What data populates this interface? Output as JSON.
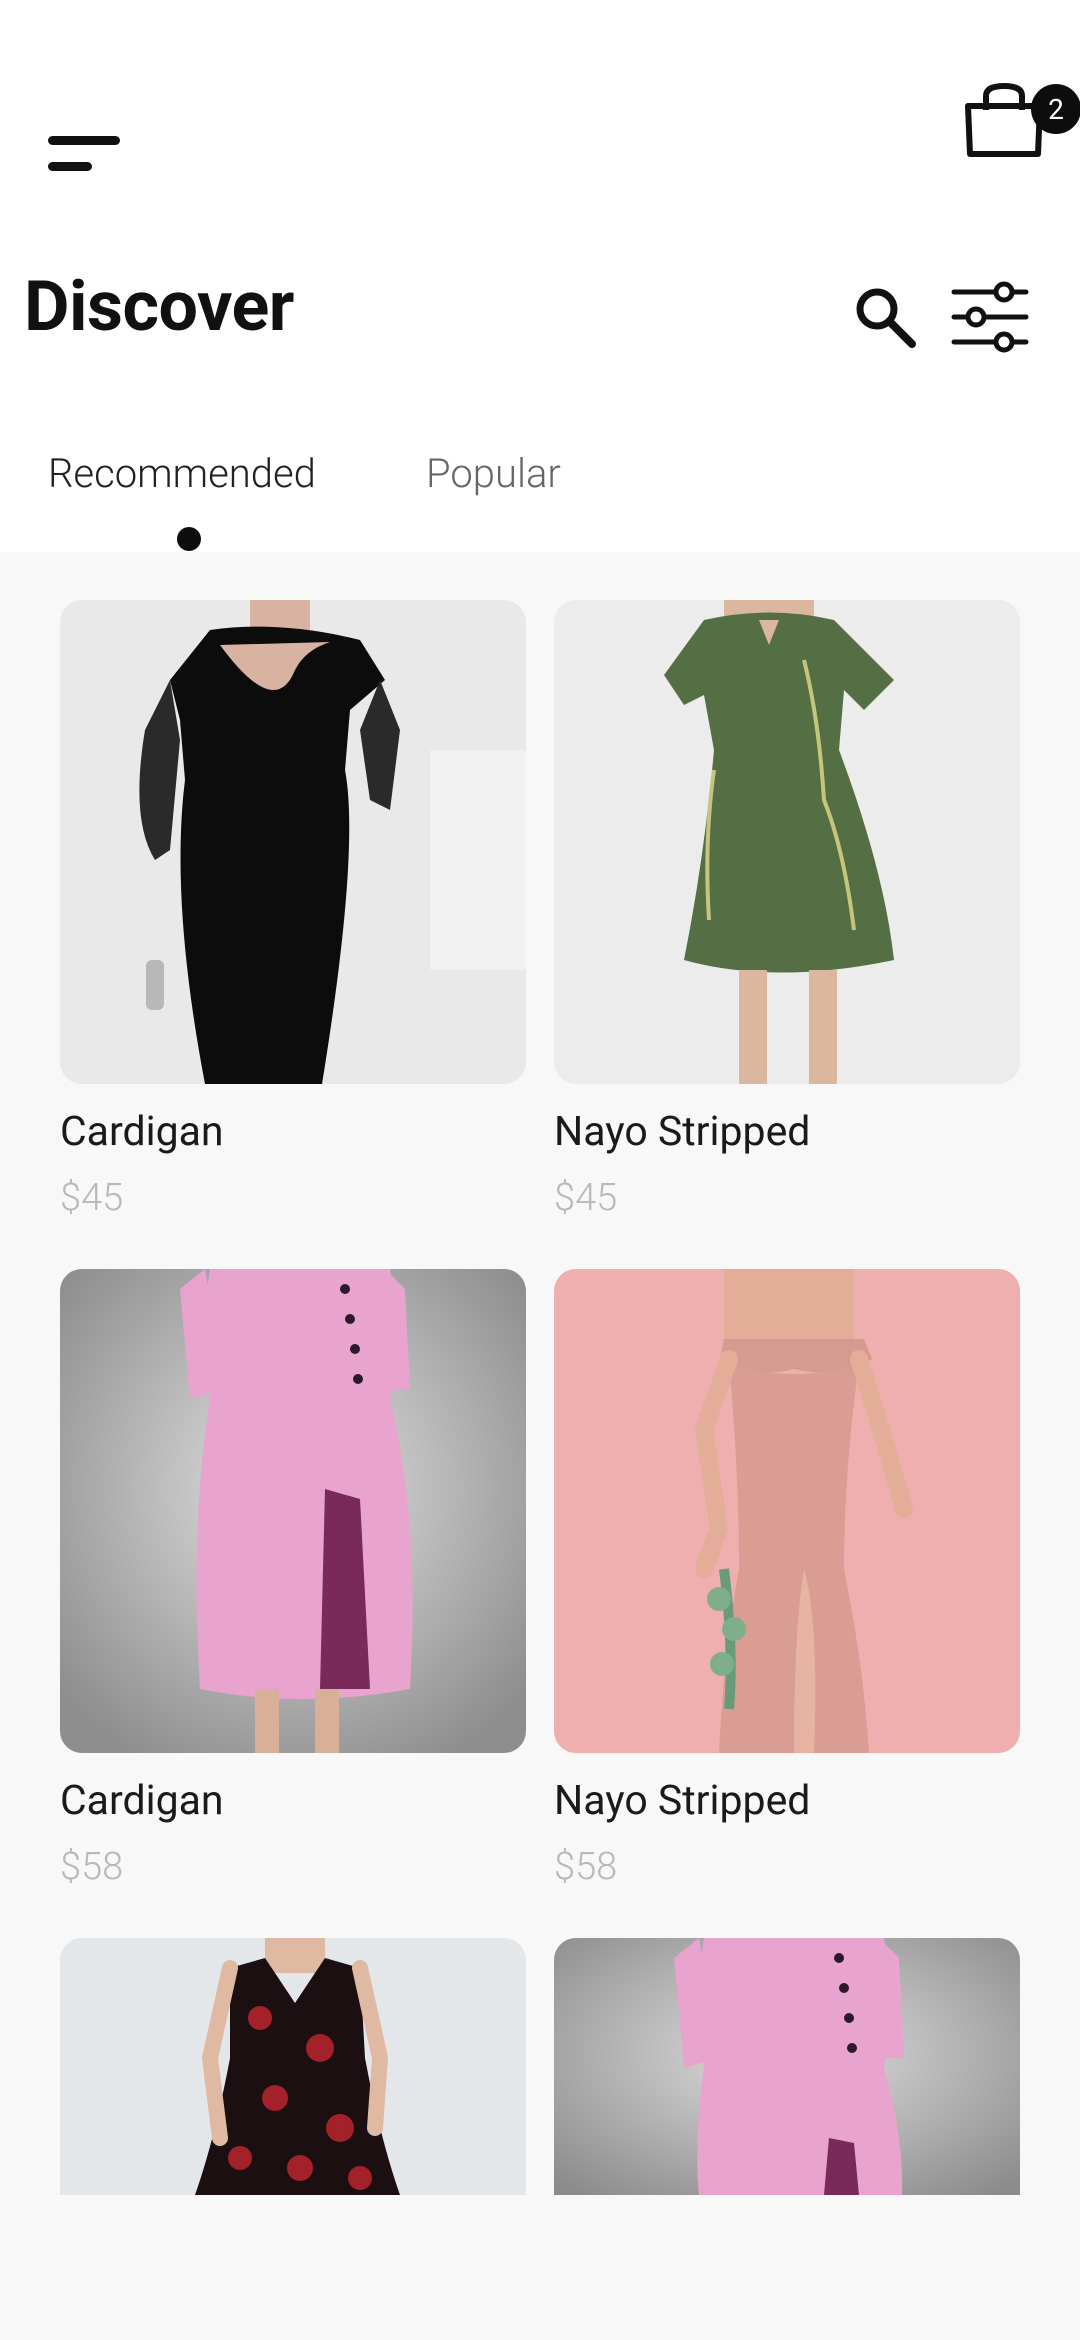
{
  "header": {
    "cart_count": "2",
    "title": "Discover"
  },
  "tabs": [
    {
      "label": "Recommended",
      "active": true
    },
    {
      "label": "Popular",
      "active": false
    }
  ],
  "products": [
    {
      "name": "Cardigan",
      "price": "$45"
    },
    {
      "name": "Nayo Stripped",
      "price": "$45"
    },
    {
      "name": "Cardigan",
      "price": "$58"
    },
    {
      "name": "Nayo Stripped",
      "price": "$58"
    },
    {
      "name": "",
      "price": ""
    },
    {
      "name": "",
      "price": ""
    }
  ],
  "colors": {
    "ink": "#111111",
    "muted": "#b8b8b8",
    "background": "#f8f8f8"
  }
}
